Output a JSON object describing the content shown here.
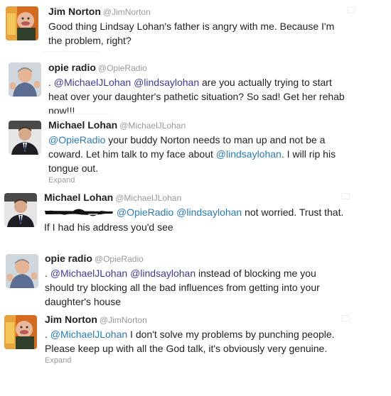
{
  "tweets": [
    {
      "name": "Jim Norton",
      "handle": "@JimNorton",
      "text": "Good thing Lindsay Lohan's father is angry with me. Because I'm the problem, right?",
      "expand": ""
    },
    {
      "name": "opie radio",
      "handle": "@OpieRadio",
      "prefix": ". ",
      "mention1": "@MichaelJLohan",
      "mention2": "@lindsaylohan",
      "text": " are you actually trying to start heat over your daughter's pathetic situation? So sad! Get her rehab now!!!"
    },
    {
      "name": "Michael Lohan",
      "handle": "@MichaelJLohan",
      "mention1": "@OpieRadio",
      "text1": " your buddy Norton needs to man up and not be a coward. Let him talk to my face about ",
      "mention2": "@lindsaylohan",
      "text2": ". I will rip his tongue out.",
      "expand": "Expand"
    },
    {
      "name": "Michael Lohan",
      "handle": "@MichaelJLohan",
      "mention1": "@OpieRadio",
      "mention2": "@lindsaylohan",
      "text1": " not worried. Trust that.",
      "text2": "If I had his address you'd see"
    },
    {
      "name": "opie radio",
      "handle": "@OpieRadio",
      "prefix": ". ",
      "mention1": "@MichaelJLohan",
      "mention2": "@lindsaylohan",
      "text": " instead of blocking me you should try blocking all the bad influences from getting into your daughter's house"
    },
    {
      "name": "Jim Norton",
      "handle": "@JimNorton",
      "prefix": ". ",
      "mention1": "@MichaelJLohan",
      "text": " I don't solve my problems by punching people. Please keep up with all the God talk, it's obviously very genuine.",
      "expand": "Expand"
    }
  ],
  "colors": {
    "link": "#2b7bb9",
    "link_visited": "#3b3b9c",
    "text": "#222222",
    "meta": "#999999"
  },
  "icons": {
    "avatar_jim": "avatar-jim-norton-icon",
    "avatar_opie": "avatar-opie-radio-icon",
    "avatar_michael": "avatar-michael-lohan-icon"
  }
}
